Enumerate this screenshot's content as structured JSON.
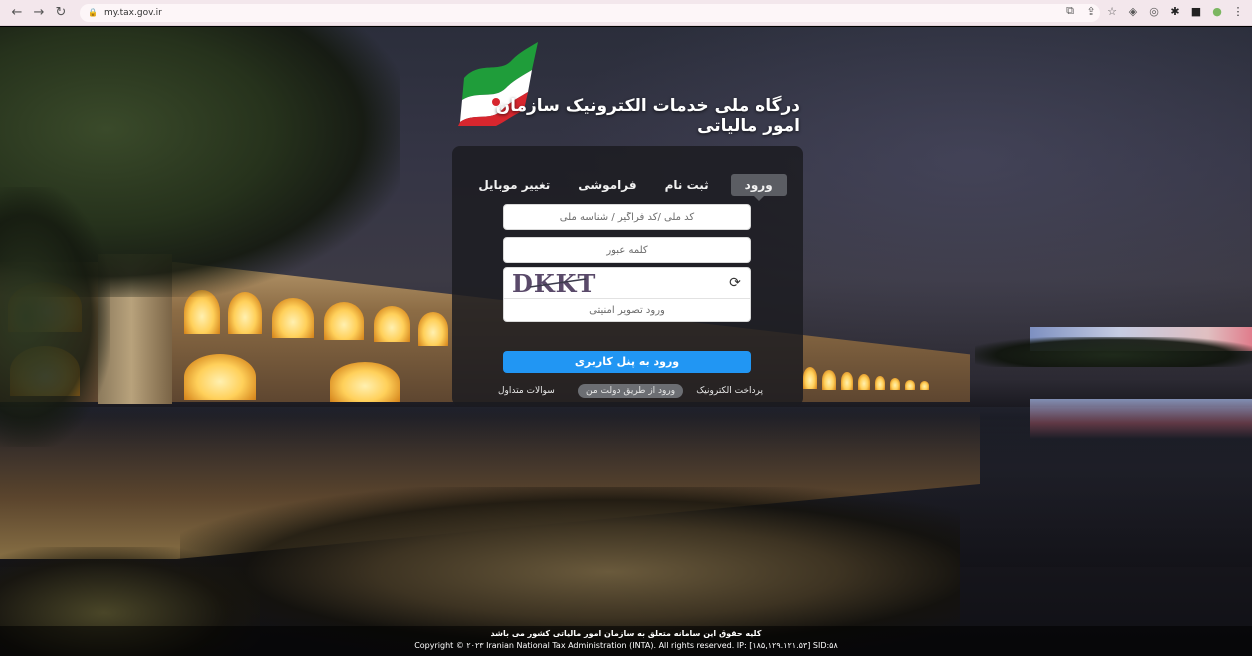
{
  "browser": {
    "url": "my.tax.gov.ir",
    "back_icon": "←",
    "forward_icon": "→",
    "reload_icon": "↻"
  },
  "header": {
    "title": "درگاه ملی خدمات الکترونیک سازمان امور مالیاتی"
  },
  "login": {
    "tabs": [
      {
        "label": "ورود",
        "active": true
      },
      {
        "label": "ثبت نام",
        "active": false
      },
      {
        "label": "فراموشی",
        "active": false
      },
      {
        "label": "تغییر موبایل",
        "active": false
      }
    ],
    "username_placeholder": "کد ملی /کد فراگیر / شناسه ملی",
    "password_placeholder": "کلمه عبور",
    "captcha_text": "DKKT",
    "captcha_placeholder": "ورود تصویر امنیتی",
    "submit_label": "ورود به پنل کاربری"
  },
  "links": {
    "payment": "پرداخت الکترونیک",
    "gov_login": "ورود از طریق دولت من",
    "faq": "سوالات متداول"
  },
  "footer": {
    "rights": "کلیه حقوق این سامانه متعلق به سازمان امور مالیاتی کشور می باشد",
    "copyright": "Copyright © ۲۰۲۳ Iranian National Tax Administration (INTA). All rights reserved. IP: [۱۸۵,۱۲۹.۱۲۱.۵۳] SID:۵۸"
  },
  "colors": {
    "submit": "#2196f3",
    "panel": "#1c1c20",
    "active_tab": "#5b5d63",
    "flag_green": "#1f9d3a",
    "flag_red": "#d7262e"
  }
}
